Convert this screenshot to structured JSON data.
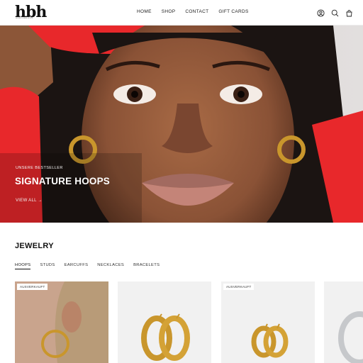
{
  "header": {
    "logo": "hbh",
    "logo_sub": "HOUSE OF BEBE HOOPS",
    "nav": [
      "HOME",
      "SHOP",
      "CONTACT",
      "GIFT CARDS"
    ],
    "icons": [
      "account-icon",
      "search-icon",
      "cart-icon"
    ]
  },
  "hero": {
    "kicker": "UNSERE BESTSELLER",
    "title": "SIGNATURE HOOPS",
    "link": "VIEW ALL →"
  },
  "jewelry": {
    "title": "JEWELRY",
    "tabs": [
      "HOOPS",
      "STUDS",
      "EARCUFFS",
      "NECKLACES",
      "BRACELETS"
    ],
    "active_tab": "HOOPS",
    "products": [
      {
        "badge": "AUSVERKAUFT",
        "image": "model-ear-gold-hoop"
      },
      {
        "badge": "",
        "image": "gold-chunky-hoops"
      },
      {
        "badge": "AUSVERKAUFT",
        "image": "small-gold-hoops"
      },
      {
        "badge": "",
        "image": "silver-hoop"
      }
    ]
  },
  "colors": {
    "red_sleeve": "#e8282b",
    "gold": "#c9962c",
    "skin": "#8a5236"
  }
}
